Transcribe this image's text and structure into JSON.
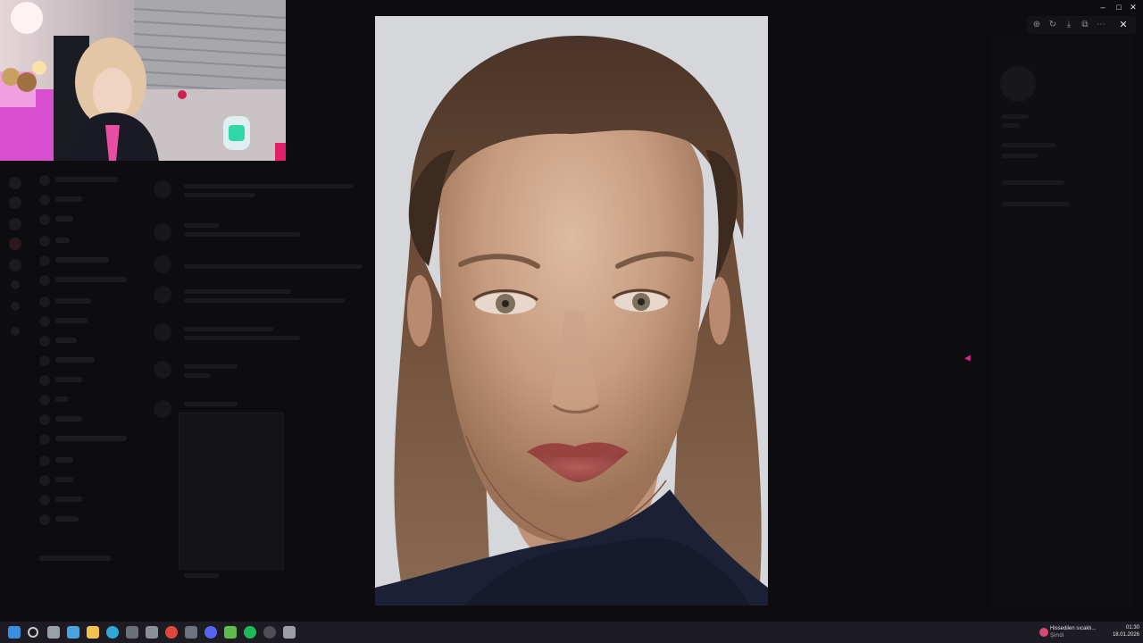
{
  "window": {
    "title": "",
    "controls": {
      "minimize": "–",
      "maximize": "□",
      "close": "✕"
    }
  },
  "viewer": {
    "toolbar_icons": [
      "zoom-icon",
      "rotate-icon",
      "download-icon",
      "open-external-icon",
      "more-icon"
    ],
    "toolbar_glyphs": [
      "⊕",
      "↻",
      "⤓",
      "⧉",
      "⋯"
    ],
    "close_glyph": "✕",
    "image_subject": "digital portrait painting"
  },
  "taskbar": {
    "apps": [
      "windows-start-icon",
      "search-icon",
      "task-view-icon",
      "widgets-icon",
      "file-explorer-icon",
      "edge-icon",
      "store-icon",
      "settings-icon",
      "chrome-icon",
      "camera-icon",
      "discord-icon",
      "xbox-icon",
      "spotify-icon",
      "obs-icon",
      "app-icon"
    ],
    "app_colors": [
      "#3a8ee6",
      "#c9cbd0",
      "#9aa0a8",
      "#4aa3e0",
      "#f2c14e",
      "#2fa7d9",
      "#6a6f78",
      "#8a8f98",
      "#e0473a",
      "#6d7380",
      "#5865f2",
      "#5fb94c",
      "#1db954",
      "#4d4f55",
      "#9b9ea6"
    ],
    "weather": {
      "line1": "Hissedilen sıcaklı...",
      "line2": "Şimdi"
    },
    "clock": {
      "time": "01:30",
      "date": "18.01.2026"
    }
  },
  "colors": {
    "background": "#0b0b0c",
    "accent_cursor": "#e01e8e",
    "skin": "#d4a98c",
    "hair": "#5a4030",
    "lips": "#a34a4a"
  }
}
